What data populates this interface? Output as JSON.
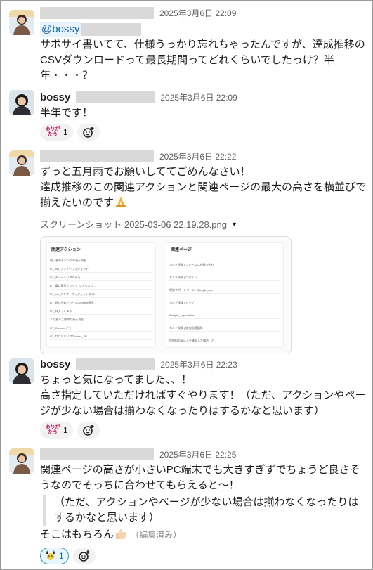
{
  "messages": [
    {
      "time": "2025年3月6日 22:09",
      "mention": "@bossy",
      "text": "サポサイ書いてて、仕様うっかり忘れちゃったんですが、達成推移のCSVダウンロードって最長期間ってどれくらいでしたっけ？半年・・・？"
    },
    {
      "name": "bossy",
      "time": "2025年3月6日 22:09",
      "text": "半年です！",
      "reaction": {
        "label": "ありがたう",
        "count": "1"
      }
    },
    {
      "time": "2025年3月6日 22:22",
      "line1": "ずっと五月雨でお願いしててごめんなさい！",
      "line2": "達成推移のこの関連アクションと関連ページの最大の高さを横並びで揃えたいのです",
      "file_name": "スクリーンショット 2025-03-06 22.19.28.png",
      "preview": {
        "left_title": "関連アクション",
        "right_title": "関連ページ",
        "left_rows": [
          "問い合わせリンクの表示消去",
          "RT_top_アンサーウィジェット",
          "RT_チュートリアルデモ",
          "RT_電話番号クリック_シナリオウ...",
          "RT_top_アンサーウィジェットのコ...",
          "RT_問い合わせページConnect表示...",
          "RT_ログインエラー",
          "よくあるご質問の表示消去",
          "RT_Connectデモ",
          "RT_サクマドリクスdemo_SP"
        ],
        "right_rows": [
          "カルテ保険 | フォームでお問い合わ",
          "カルテ保険 | ログイン",
          "保険サポートページ - Sample_sup",
          "カルテ保険 | トップ",
          "Sample_supportsite",
          "カルテ保険 | 総合医療保険",
          "保険料の見込しを確認した場合、ど"
        ]
      }
    },
    {
      "name": "bossy",
      "time": "2025年3月6日 22:23",
      "line1": "ちょっと気になってました、、！",
      "line2": "高さ指定していただければすぐやります！（ただ、アクションやページが少ない場合は揃わなくなったりはするかなと思います）",
      "reaction": {
        "label": "ありがたう",
        "count": "1"
      }
    },
    {
      "time": "2025年3月6日 22:25",
      "text": "関連ページの高さが小さいPC端末でも大きすぎずでちょうど良さそうなのでそっちに合わせてもらえると〜！",
      "quote": "（ただ、アクションやページが少ない場合は揃わなくなったりはするかなと思います）",
      "closing": "そこはもちろん",
      "edited": "（編集済み）",
      "reaction": {
        "icon": "pikachu-icon",
        "count": "1"
      }
    }
  ]
}
